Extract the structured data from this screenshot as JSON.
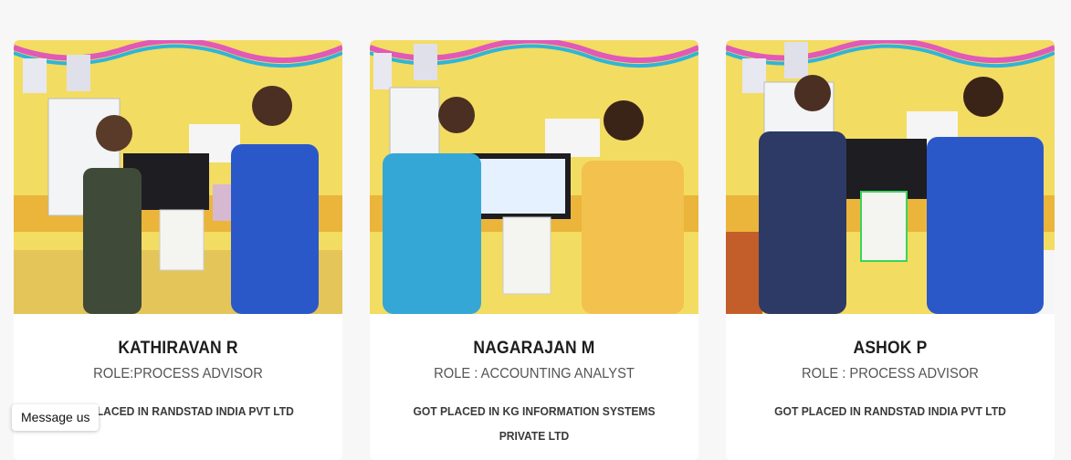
{
  "cards": [
    {
      "name": "KATHIRAVAN R",
      "role": "ROLE:PROCESS ADVISOR",
      "placed": "GOT PLACED IN RANDSTAD INDIA PVT LTD",
      "photo_alt": "placement-photo"
    },
    {
      "name": "NAGARAJAN M",
      "role": "ROLE : ACCOUNTING ANALYST",
      "placed": "GOT PLACED IN KG INFORMATION SYSTEMS PRIVATE LTD",
      "photo_alt": "placement-photo"
    },
    {
      "name": "ASHOK P",
      "role": "ROLE : PROCESS ADVISOR",
      "placed": "GOT PLACED IN RANDSTAD INDIA PVT LTD",
      "photo_alt": "placement-photo"
    }
  ],
  "chat": {
    "label": "Message us"
  },
  "colors": {
    "wall": "#f3dc62",
    "stripe": "#eab53a",
    "shirt_blue": "#2b58c9",
    "paper": "#f4f4f0"
  }
}
